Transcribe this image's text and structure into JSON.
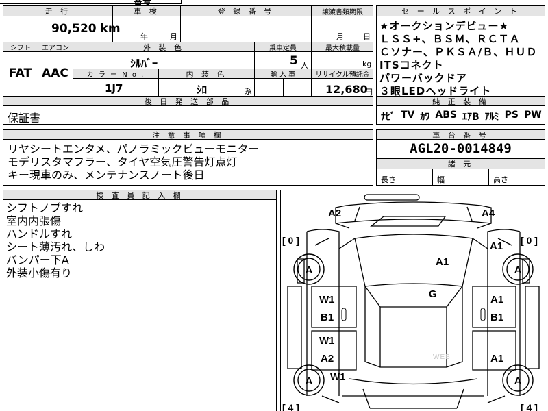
{
  "top_fragment": "番号",
  "mileage": {
    "header": "走 行",
    "value": "90,520",
    "unit": "km"
  },
  "inspection": {
    "header": "車 検",
    "year_unit": "年",
    "month_unit": "月"
  },
  "registration": {
    "header": "登 録 番 号"
  },
  "transfer": {
    "header": "譲渡書類期限",
    "month_unit": "月",
    "day_unit": "日"
  },
  "shift": {
    "header": "シフト",
    "value": "FAT"
  },
  "aircon": {
    "header": "エアコン",
    "value": "AAC"
  },
  "exterior_color": {
    "header": "外 装 色",
    "value": "ｼﾙﾊﾞｰ"
  },
  "capacity": {
    "header": "乗車定員",
    "value": "5",
    "unit": "人"
  },
  "max_load": {
    "header": "最大積載量",
    "unit": "kg"
  },
  "color_no": {
    "header": "カ ラ ー N o .",
    "value": "1J7"
  },
  "interior_color": {
    "header": "内 装 色",
    "value": "ｼﾛ",
    "suffix": "系"
  },
  "import": {
    "header": "輸 入 車"
  },
  "recycle": {
    "header": "リサイクル預託金",
    "value": "12,680",
    "unit": "円"
  },
  "shipping": {
    "header": "後 日 発 送 部 品",
    "items": [
      "保証書"
    ]
  },
  "selling_points": {
    "header": "セ ー ル ス ポ イ ン ト",
    "lines": [
      "★オークションデビュー★",
      "ＬＳＳ+、ＢＳＭ、ＲＣＴＡ",
      "Ｃソナー、ＰＫＳＡ/Ｂ、ＨＵＤ",
      "ITSコネクト",
      "パワーバックドア",
      "３眼LEDヘッドライト"
    ]
  },
  "equipment": {
    "header": "純 正 装 備",
    "items": [
      "ﾅﾋﾞ",
      "TV",
      "ｶﾜ",
      "ABS",
      "ｴｱB",
      "ｱﾙﾐ",
      "PS",
      "PW"
    ]
  },
  "notes": {
    "header": "注 意 事 項 欄",
    "lines": [
      "リヤシートエンタメ、パノラミックビューモニター",
      "モデリスタマフラー、タイヤ空気圧警告灯点灯",
      "キー現車のみ、メンテナンスノート後日"
    ]
  },
  "chassis": {
    "header": "車 台 番 号",
    "value": "AGL20-0014849"
  },
  "dimensions": {
    "header": "諸 元",
    "length": "長さ",
    "width": "幅",
    "height": "高さ"
  },
  "inspector": {
    "header": "検 査 員 記 入 欄",
    "lines": [
      "シフトノブすれ",
      "室内内張傷",
      "ハンドルすれ",
      "シート薄汚れ、しわ",
      "バンパー下A",
      "外装小傷有り"
    ]
  },
  "diagram": {
    "codes": [
      "A2",
      "A4",
      "A1",
      "A1",
      "G",
      "W1",
      "B1",
      "A1",
      "B1",
      "W1",
      "A2",
      "A1",
      "W1"
    ],
    "wheel_marks": [
      "A",
      "A",
      "A",
      "A"
    ],
    "tread_labels": [
      "[ 0 ]",
      "[ 0 ]",
      "[ 4 ]",
      "[ 4 ]"
    ],
    "watermark": "WEB"
  }
}
